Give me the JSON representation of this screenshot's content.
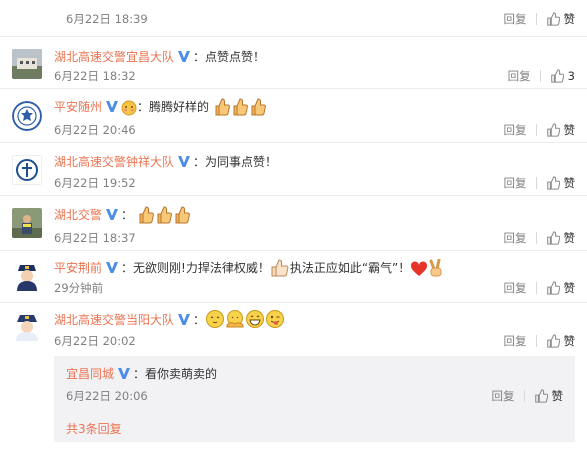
{
  "comments": [
    {
      "user": "",
      "text": "",
      "time": "6月22日 18:39",
      "reply_label": "回复",
      "like_label": "赞",
      "likes": ""
    },
    {
      "user": "湖北高速交警宜昌大队",
      "text": "：点赞点赞！",
      "time": "6月22日 18:32",
      "reply_label": "回复",
      "likes": "3"
    },
    {
      "user": "平安随州",
      "text": "：腾腾好样的",
      "time": "6月22日 20:46",
      "reply_label": "回复",
      "like_label": "赞"
    },
    {
      "user": "湖北高速交警钟祥大队",
      "text": "：为同事点赞！",
      "time": "6月22日 19:52",
      "reply_label": "回复",
      "like_label": "赞"
    },
    {
      "user": "湖北交警",
      "text": "：",
      "time": "6月22日 18:37",
      "reply_label": "回复",
      "like_label": "赞"
    },
    {
      "user": "平安荆前",
      "text_a": "：无欲则刚!力捍法律权威！",
      "text_b": "执法正应如此“霸气”！",
      "time": "29分钟前",
      "reply_label": "回复",
      "like_label": "赞"
    },
    {
      "user": "湖北高速交警当阳大队",
      "text": "：",
      "time": "6月22日 20:02",
      "reply_label": "回复",
      "like_label": "赞"
    }
  ],
  "reply": {
    "user": "宜昌同城",
    "text": "：看你卖萌卖的",
    "time": "6月22日 20:06",
    "reply_label": "回复",
    "like_label": "赞",
    "more": "共3条回复"
  },
  "colors": {
    "username": "#eb7350",
    "verified": "#4d8de8",
    "muted": "#808080",
    "reply_bg": "#f2f2f5"
  }
}
